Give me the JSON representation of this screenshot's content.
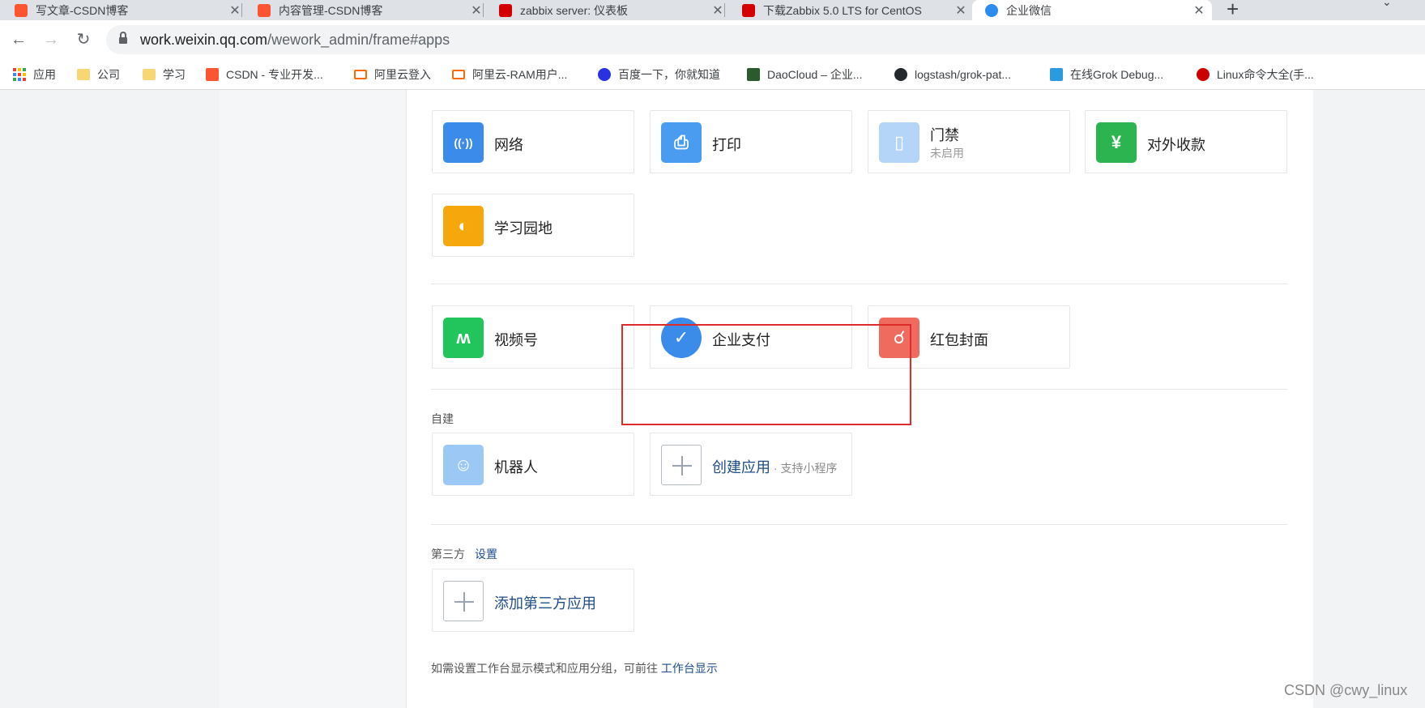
{
  "tabs": [
    {
      "title": "写文章-CSDN博客",
      "favicon_color": "#fc5531",
      "active": false
    },
    {
      "title": "内容管理-CSDN博客",
      "favicon_color": "#fc5531",
      "active": false
    },
    {
      "title": "zabbix server: 仪表板",
      "favicon_color": "#d40000",
      "active": false
    },
    {
      "title": "下载Zabbix 5.0 LTS for CentOS",
      "favicon_color": "#d40000",
      "active": false
    },
    {
      "title": "企业微信",
      "favicon_color": "#2d8cf0",
      "active": true
    }
  ],
  "tab_close_glyph": "✕",
  "new_tab_glyph": "+",
  "address": {
    "host": "work.weixin.qq.com",
    "path": "/wework_admin/frame#apps"
  },
  "nav": {
    "back": "←",
    "forward": "→",
    "reload": "↻"
  },
  "bookmarks": [
    {
      "label": "应用",
      "icon": "apps-grid-icon"
    },
    {
      "label": "公司",
      "icon": "folder-icon",
      "color": "#f7d774"
    },
    {
      "label": "学习",
      "icon": "folder-icon",
      "color": "#f7d774"
    },
    {
      "label": "CSDN - 专业开发...",
      "icon": "csdn-icon",
      "color": "#fc5531"
    },
    {
      "label": "阿里云登入",
      "icon": "aliyun-icon",
      "color": "#ff6a00"
    },
    {
      "label": "阿里云-RAM用户...",
      "icon": "aliyun-icon",
      "color": "#ff6a00"
    },
    {
      "label": "百度一下，你就知道",
      "icon": "baidu-icon",
      "color": "#2932e1"
    },
    {
      "label": "DaoCloud – 企业...",
      "icon": "daocloud-icon",
      "color": "#2c5a2f"
    },
    {
      "label": "logstash/grok-pat...",
      "icon": "github-icon",
      "color": "#24292e"
    },
    {
      "label": "在线Grok Debug...",
      "icon": "grok-icon",
      "color": "#2b9be0"
    },
    {
      "label": "Linux命令大全(手...",
      "icon": "redhat-icon",
      "color": "#cc0000"
    }
  ],
  "apps_row1": [
    {
      "label": "网络",
      "icon": "router-icon",
      "color": "#3b8cea",
      "glyph": "((·))"
    },
    {
      "label": "打印",
      "icon": "printer-icon",
      "color": "#4a9cf0",
      "glyph": "🖶"
    },
    {
      "label": "门禁",
      "sub": "未启用",
      "icon": "door-icon",
      "color": "#b4d4f8",
      "glyph": "▯"
    },
    {
      "label": "对外收款",
      "icon": "yuan-shield-icon",
      "color": "#2cb450",
      "glyph": "¥"
    }
  ],
  "apps_row2": [
    {
      "label": "学习园地",
      "icon": "planet-icon",
      "color": "#f5a70c",
      "glyph": "◐"
    }
  ],
  "apps_row3": [
    {
      "label": "视频号",
      "icon": "channels-icon",
      "color": "#21c55b",
      "glyph": "ʍ"
    },
    {
      "label": "企业支付",
      "icon": "pay-bubble-icon",
      "color": "#3b8cea",
      "glyph": "✓"
    },
    {
      "label": "红包封面",
      "icon": "red-packet-icon",
      "color": "#ee6b5e",
      "glyph": "☌"
    }
  ],
  "self_built": {
    "section": "自建",
    "robot": {
      "label": "机器人",
      "icon": "robot-icon",
      "color": "#9cc8f5"
    },
    "create": {
      "label": "创建应用",
      "suffix": " · 支持小程序"
    }
  },
  "third_party": {
    "section": "第三方",
    "settings_link": "设置",
    "add": {
      "label": "添加第三方应用"
    }
  },
  "footnote": {
    "text": "如需设置工作台显示模式和应用分组，可前往 ",
    "link": "工作台显示"
  },
  "watermark": "CSDN @cwy_linux"
}
